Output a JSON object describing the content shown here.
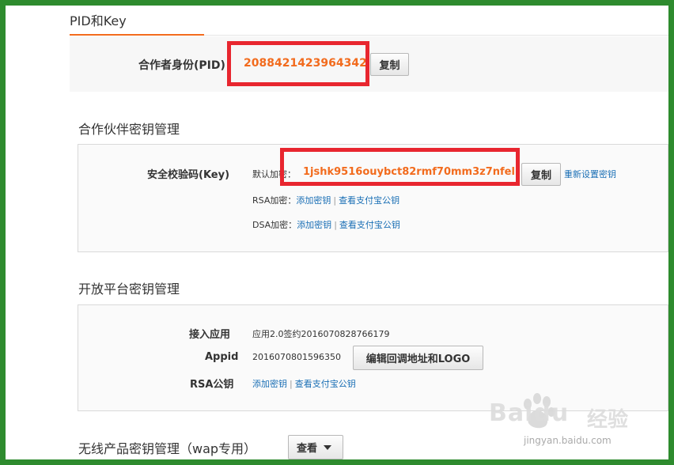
{
  "tab": {
    "title": "PID和Key"
  },
  "pid": {
    "label": "合作者身份(PID)",
    "value": "2088421423964342",
    "copy_label": "复制"
  },
  "partner_key": {
    "section_title": "合作伙伴密钥管理",
    "security_label": "安全校验码(Key)",
    "default_prefix": "默认加密：",
    "key_value": "1jshk9516ouybct82rmf70mm3z7nfell",
    "copy_label": "复制",
    "reset_link": "重新设置密钥",
    "rsa_prefix": "RSA加密：",
    "dsa_prefix": "DSA加密：",
    "add_key": "添加密钥",
    "view_alipay_key": "查看支付宝公钥",
    "separator": "|"
  },
  "open_platform": {
    "section_title": "开放平台密钥管理",
    "app_label": "接入应用",
    "app_value": "应用2.0签约2016070828766179",
    "appid_label": "Appid",
    "appid_value": "2016070801596350",
    "edit_button": "编辑回调地址和LOGO",
    "rsa_label": "RSA公钥",
    "add_key": "添加密钥",
    "view_alipay_key": "查看支付宝公钥",
    "separator": "|"
  },
  "wireless": {
    "section_title": "无线产品密钥管理（wap专用）",
    "view_button": "查看"
  },
  "watermark": {
    "brand": "Baidu",
    "cn": "经验",
    "url": "jingyan.baidu.com"
  },
  "colors": {
    "accent": "#f26b1d",
    "highlight_box": "#e8262f",
    "frame": "#2e8b2e",
    "link": "#1a6fb5"
  }
}
